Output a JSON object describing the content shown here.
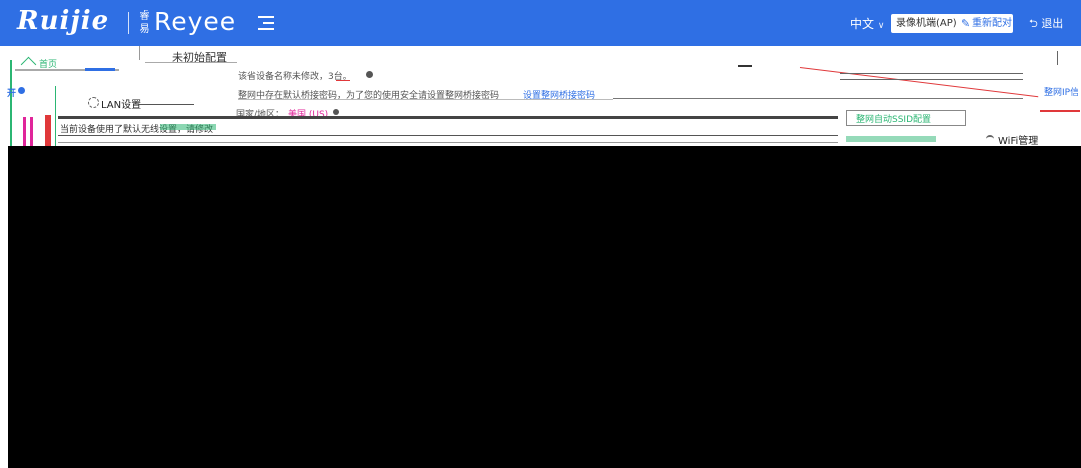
{
  "header": {
    "brand_ruijie": "Ruijie",
    "brand_sep": "|",
    "brand_reyee_mark": "睿易",
    "brand_reyee": "Reyee",
    "menu_icon": "menu-icon",
    "language": "中文",
    "language_chevron": "∨",
    "mode_label": "录像机端(AP)",
    "pencil_icon": "✎",
    "repair_label": "重新配对",
    "logout_icon": "⮌",
    "logout_label": "退出"
  },
  "content": {
    "status_uninitialized": "未初始配置",
    "home_label": "首页",
    "left_open_label": "开",
    "lan_settings": "LAN设置",
    "device_name_hint": "该省设备名称未修改，3台。",
    "bridge_password_warning": "整网中存在默认桥接密码，为了您的使用安全请设置整网桥接密码",
    "set_bridge_password_link": "设置整网桥接密码",
    "country_label": "国家/地区：",
    "country_value": "美国 (US)",
    "current_device_notice": "当前设备使用了默认无线设置，请修改",
    "network_ip_label": "整网IP信",
    "ssid_config_label": "整网自动SSID配置",
    "wifi_manage_label": "WiFi管理"
  },
  "colors": {
    "header_bg": "#2f6fe4",
    "link_blue": "#2f6fe4",
    "alert_red": "#e0383a",
    "ok_green": "#2bb673",
    "highlight_magenta": "#e0259a"
  }
}
